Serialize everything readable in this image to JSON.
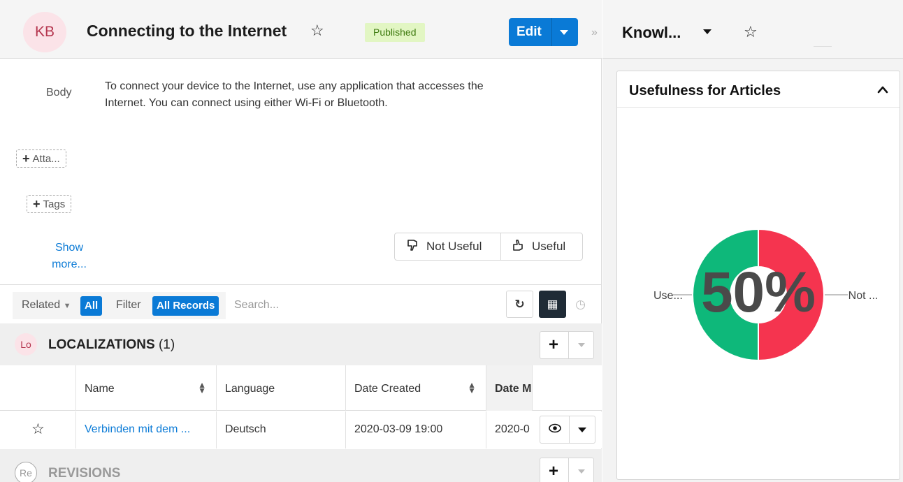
{
  "record": {
    "avatar": "KB",
    "title": "Connecting to the Internet",
    "status": "Published",
    "edit_label": "Edit"
  },
  "fields": {
    "body_label": "Body",
    "body_text": "To connect your device to the Internet, use any application that accesses the Internet. You can connect using either Wi-Fi or Bluetooth.",
    "attach_label": "Atta...",
    "tags_label": "Tags",
    "show_more": "Show more..."
  },
  "feedback": {
    "not_useful": "Not Useful",
    "useful": "Useful"
  },
  "related_bar": {
    "related_label": "Related",
    "related_value": "All",
    "filter_label": "Filter",
    "filter_value": "All Records",
    "search_placeholder": "Search..."
  },
  "subpanels": [
    {
      "avatar": "Lo",
      "title": "LOCALIZATIONS",
      "count": "(1)"
    },
    {
      "avatar": "Re",
      "title": "REVISIONS",
      "count": ""
    }
  ],
  "table": {
    "columns": [
      "Name",
      "Language",
      "Date Created",
      "Date M"
    ],
    "rows": [
      {
        "name": "Verbinden mit dem ...",
        "language": "Deutsch",
        "date_created": "2020-03-09 19:00",
        "date_modified": "2020-0"
      }
    ]
  },
  "sidebar": {
    "title": "Knowl...",
    "dashlet_title": "Usefulness for Articles"
  },
  "chart_data": {
    "type": "pie",
    "title": "",
    "center_label": "50%",
    "slices": [
      {
        "label": "Use...",
        "value": 50,
        "color": "#0eb87a"
      },
      {
        "label": "Not ...",
        "value": 50,
        "color": "#f5344f"
      }
    ]
  },
  "colors": {
    "accent": "#0a7ad6",
    "published_bg": "#e2f6c3",
    "useful_green": "#0eb87a",
    "not_useful_red": "#f5344f"
  }
}
